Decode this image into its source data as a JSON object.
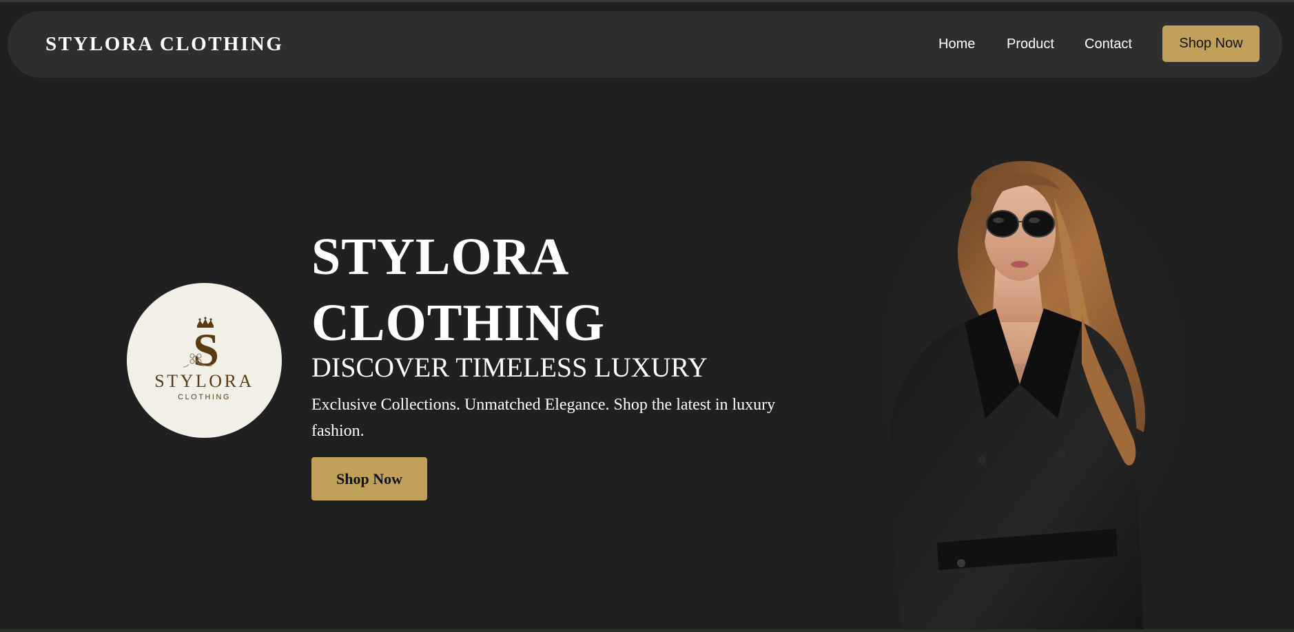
{
  "nav": {
    "brand": "STYLORA CLOTHING",
    "links": [
      "Home",
      "Product",
      "Contact"
    ],
    "cta": "Shop Now"
  },
  "logo": {
    "letter": "S",
    "wordmark": "STYLORA",
    "sub": "CLOTHING"
  },
  "hero": {
    "title_line1": "STYLORA",
    "title_line2": "CLOTHING",
    "subtitle": "DISCOVER TIMELESS LUXURY",
    "description": "Exclusive Collections. Unmatched Elegance. Shop the latest in luxury fashion.",
    "cta": "Shop Now"
  },
  "colors": {
    "background": "#202020",
    "navbar": "#2e2e2e",
    "accent_gold": "#c1a15a",
    "logo_bg": "#f3f0e8",
    "logo_brown": "#5a3a10"
  },
  "images": {
    "model": "woman-in-black-blazer-and-sunglasses"
  }
}
